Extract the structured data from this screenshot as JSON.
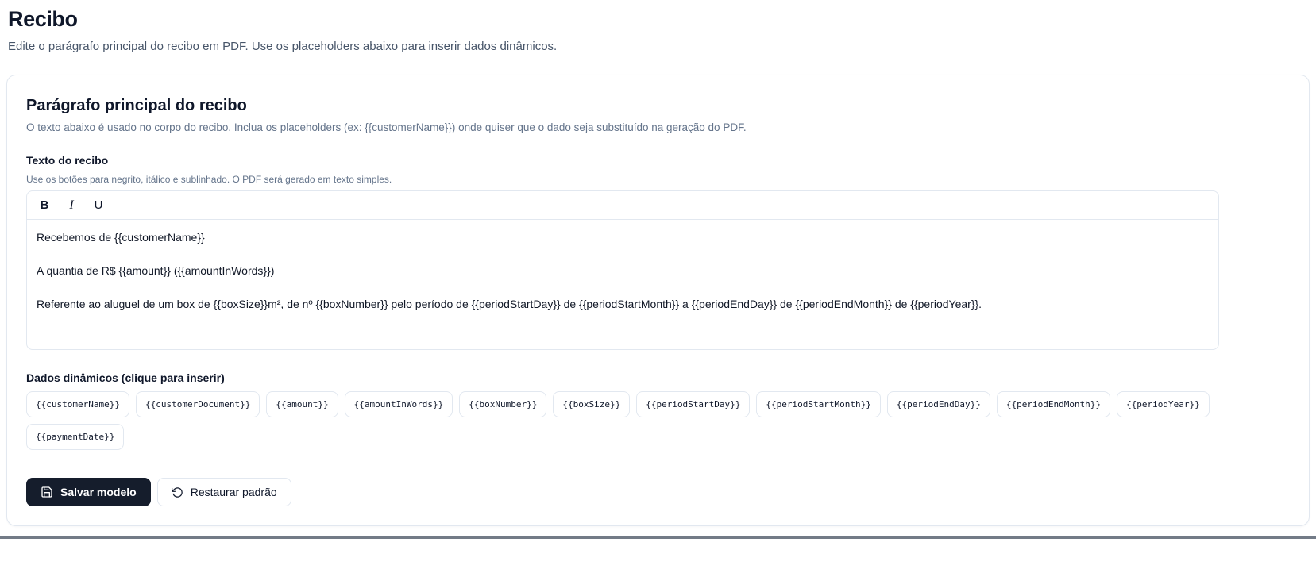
{
  "page": {
    "title": "Recibo",
    "subtitle": "Edite o parágrafo principal do recibo em PDF. Use os placeholders abaixo para inserir dados dinâmicos."
  },
  "card": {
    "title": "Parágrafo principal do recibo",
    "description": "O texto abaixo é usado no corpo do recibo. Inclua os placeholders (ex: {{customerName}}) onde quiser que o dado seja substituído na geração do PDF.",
    "editor": {
      "label": "Texto do recibo",
      "help": "Use os botões para negrito, itálico e sublinhado. O PDF será gerado em texto simples.",
      "toolbar": {
        "bold_label": "B",
        "italic_label": "I",
        "underline_label": "U"
      },
      "paragraphs": [
        "Recebemos de {{customerName}}",
        "A quantia de R$ {{amount}} ({{amountInWords}})",
        "Referente ao aluguel de um box de {{boxSize}}m², de nº {{boxNumber}} pelo período de {{periodStartDay}} de {{periodStartMonth}} a {{periodEndDay}} de {{periodEndMonth}} de {{periodYear}}."
      ]
    },
    "placeholders": {
      "label": "Dados dinâmicos (clique para inserir)",
      "chips": [
        "{{customerName}}",
        "{{customerDocument}}",
        "{{amount}}",
        "{{amountInWords}}",
        "{{boxNumber}}",
        "{{boxSize}}",
        "{{periodStartDay}}",
        "{{periodStartMonth}}",
        "{{periodEndDay}}",
        "{{periodEndMonth}}",
        "{{periodYear}}",
        "{{paymentDate}}"
      ]
    },
    "actions": {
      "save_label": "Salvar modelo",
      "restore_label": "Restaurar padrão"
    }
  },
  "colors": {
    "primary_button_bg": "#151d2c",
    "border_color": "#e2e8f0",
    "muted_text": "#64748b",
    "heading_text": "#0f172a",
    "subtitle_text": "#475569",
    "bottom_divider": "#737b87"
  }
}
